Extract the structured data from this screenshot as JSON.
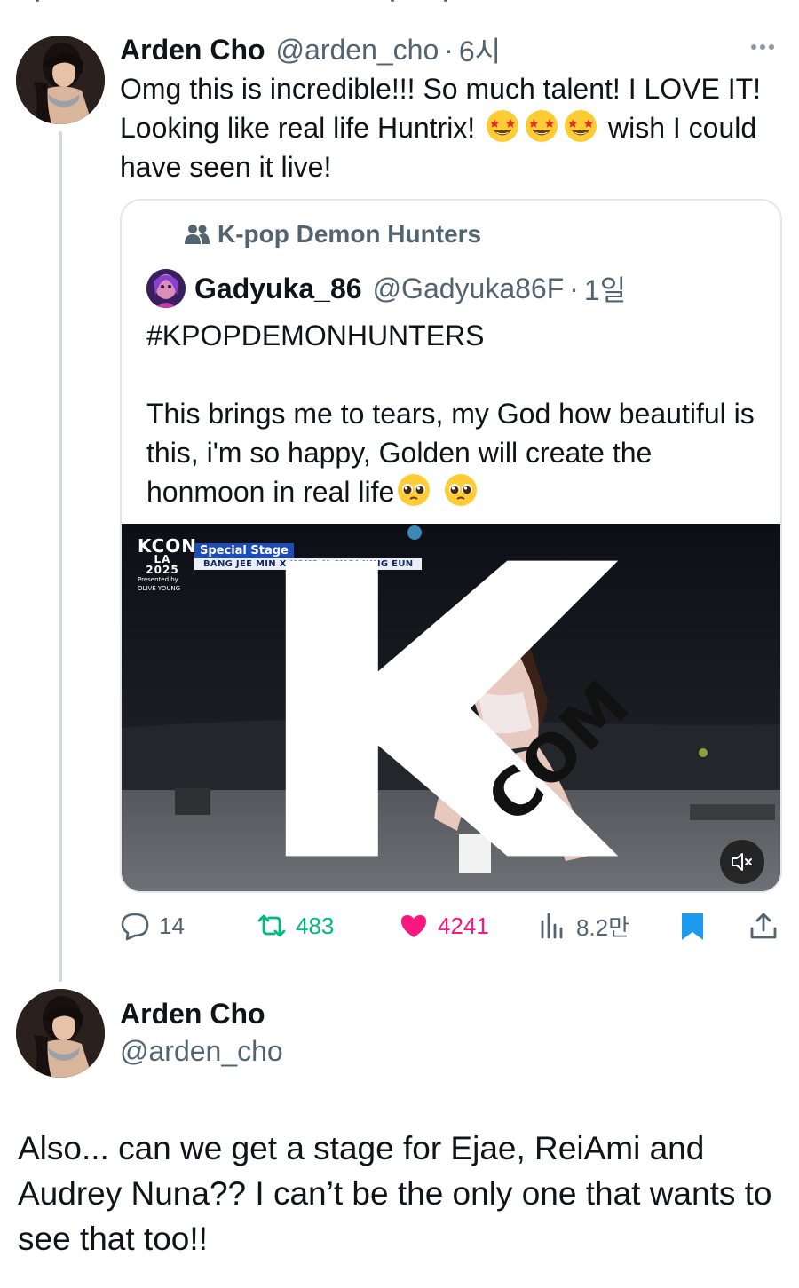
{
  "reply_tweet": {
    "author_name": "Arden Cho",
    "handle": "@arden_cho",
    "separator": "·",
    "time": "6시",
    "text_before_emoji": "Omg this is incredible!!! So much talent! I LOVE IT! Looking like real life Huntrix!",
    "text_after_emoji": "wish I could have seen it live!",
    "emoji": [
      "star-struck",
      "star-struck",
      "star-struck"
    ],
    "more_icon": "more-dots-icon"
  },
  "quoted_tweet": {
    "community": "K-pop Demon Hunters",
    "author_name": "Gadyuka_86",
    "handle": "@Gadyuka86F",
    "separator": "·",
    "time": "1일",
    "hashtag": "#KPOPDEMONHUNTERS",
    "text": "This brings me to tears, my God how beautiful is this, i'm so happy, Golden will create the honmoon in real life",
    "emoji": [
      "pleading-face",
      "pleading-face"
    ],
    "video": {
      "logo": "KCON",
      "logo_sub": "LA",
      "logo_year": "2025",
      "logo_presented": "Presented by",
      "logo_sponsor": "OLIVE YOUNG",
      "stage_label": "Special Stage",
      "performers": "BANG JEE MIN X KOKO X CHOI JUNG EUN",
      "channel_mark": "COM",
      "mute_icon": "speaker-muted-icon"
    }
  },
  "actions": {
    "replies": "14",
    "retweets": "483",
    "likes": "4241",
    "views": "8.2만",
    "liked_color": "#f91880",
    "retweet_color": "#00ba7c",
    "bookmark_color": "#1d9bf0"
  },
  "main_tweet": {
    "author_name": "Arden Cho",
    "handle": "@arden_cho",
    "text": "Also... can we get a stage for Ejae, ReiAmi and Audrey Nuna??  I can’t be the only one that wants to see that too!!"
  },
  "colors": {
    "text_primary": "#0f1419",
    "text_secondary": "#536471",
    "border": "#e1e8ed",
    "thread_line": "#cfd9de"
  }
}
